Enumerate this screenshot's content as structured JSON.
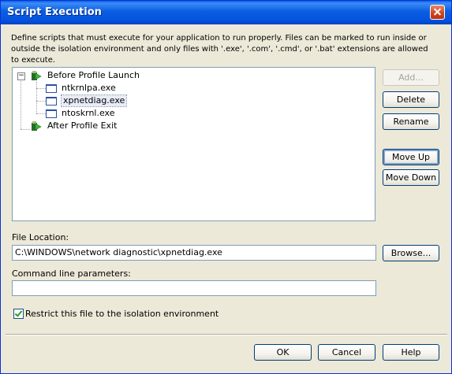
{
  "window": {
    "title": "Script Execution"
  },
  "description": "Define scripts that must execute for your application to run properly. Files can be marked to run inside or outside the isolation environment and only files with '.exe', '.com', '.cmd', or '.bat' extensions are allowed to execute.",
  "tree": {
    "groups": [
      {
        "label": "Before Profile Launch",
        "expander": "−",
        "files": [
          "ntkrnlpa.exe",
          "xpnetdiag.exe",
          "ntoskrnl.exe"
        ],
        "selected": "xpnetdiag.exe"
      },
      {
        "label": "After Profile Exit",
        "files": []
      }
    ]
  },
  "buttons": {
    "add": "Add...",
    "delete": "Delete",
    "rename": "Rename",
    "move_up": "Move Up",
    "move_down": "Move Down",
    "browse": "Browse...",
    "ok": "OK",
    "cancel": "Cancel",
    "help": "Help"
  },
  "file_location": {
    "label": "File Location:",
    "value": "C:\\WINDOWS\\network diagnostic\\xpnetdiag.exe"
  },
  "command_line": {
    "label": "Command line parameters:",
    "value": ""
  },
  "restrict": {
    "label": "Restrict this file to the isolation environment",
    "checked": true
  },
  "colors": {
    "titlebar": "#0a5ee8",
    "dialog_bg": "#ece9d8",
    "field_border": "#7f9db9"
  }
}
